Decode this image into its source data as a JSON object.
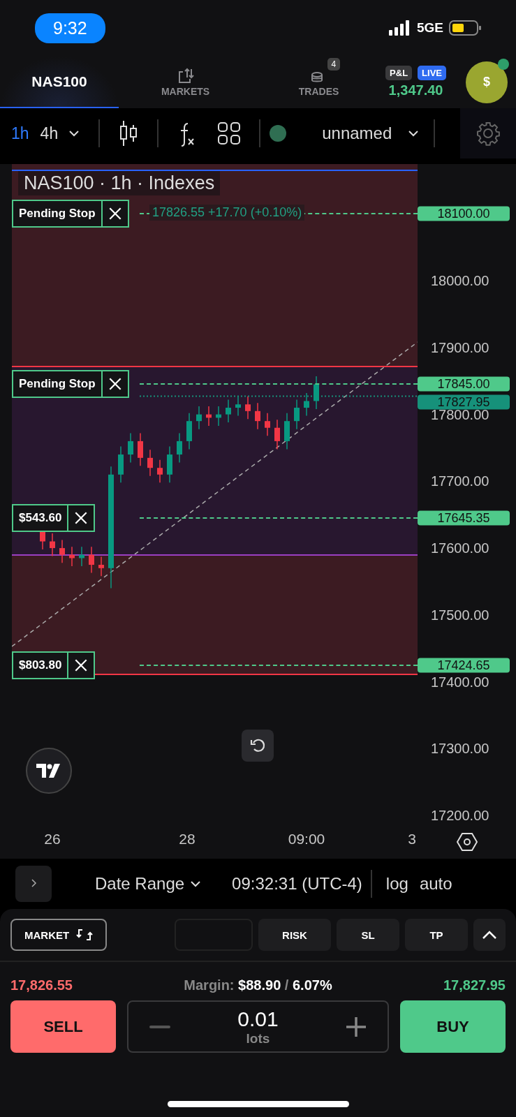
{
  "status_bar": {
    "time": "9:32",
    "network": "5GE"
  },
  "header": {
    "symbol": {
      "label": "NAS100",
      "selected": true
    },
    "nav": [
      {
        "label": "MARKETS",
        "selected": false
      },
      {
        "label": "TRADES",
        "selected": false,
        "badge": "4"
      }
    ],
    "pnl": {
      "label": "P&L",
      "mode": "LIVE",
      "value": "1,347.40"
    },
    "account": {
      "symbol": "$",
      "online": true
    }
  },
  "toolbar": {
    "intervals": [
      {
        "label": "1h",
        "selected": true
      },
      {
        "label": "4h",
        "selected": false
      }
    ],
    "layout_name": "unnamed"
  },
  "chart": {
    "title": "NAS100 · 1h · Indexes",
    "legend": "17826.55 +17.70 (+0.10%)",
    "price_axis": [
      "18000.00",
      "17900.00",
      "17800.00",
      "17700.00",
      "17600.00",
      "17500.00",
      "17400.00",
      "17300.00",
      "17200.00"
    ],
    "orders": [
      {
        "tag": "Pending Stop",
        "price": "18100.00"
      },
      {
        "tag": "Pending Stop",
        "price": "17845.00"
      },
      {
        "tag": "$543.60",
        "price": "17645.35"
      },
      {
        "tag": "$803.80",
        "price": "17424.65"
      }
    ],
    "current_price": "17827.95",
    "time_axis": [
      "26",
      "28",
      "09:00",
      "3"
    ]
  },
  "bottom_bar": {
    "date_range": "Date Range",
    "clock": "09:32:31 (UTC-4)",
    "scales": [
      "log",
      "auto"
    ]
  },
  "trade": {
    "order_type": "MARKET",
    "tabs": [
      {
        "label": "RISK",
        "selected": false
      },
      {
        "label": "SL",
        "selected": false
      },
      {
        "label": "TP",
        "selected": false
      }
    ],
    "sell": {
      "label": "SELL",
      "price": "17,826.55"
    },
    "margin": {
      "label": "Margin:",
      "amount": "$88.90",
      "separator": "/",
      "percent": "6.07%"
    },
    "buy": {
      "label": "BUY",
      "price": "17,827.95"
    },
    "lots": {
      "value": "0.01",
      "unit": "lots"
    }
  }
}
